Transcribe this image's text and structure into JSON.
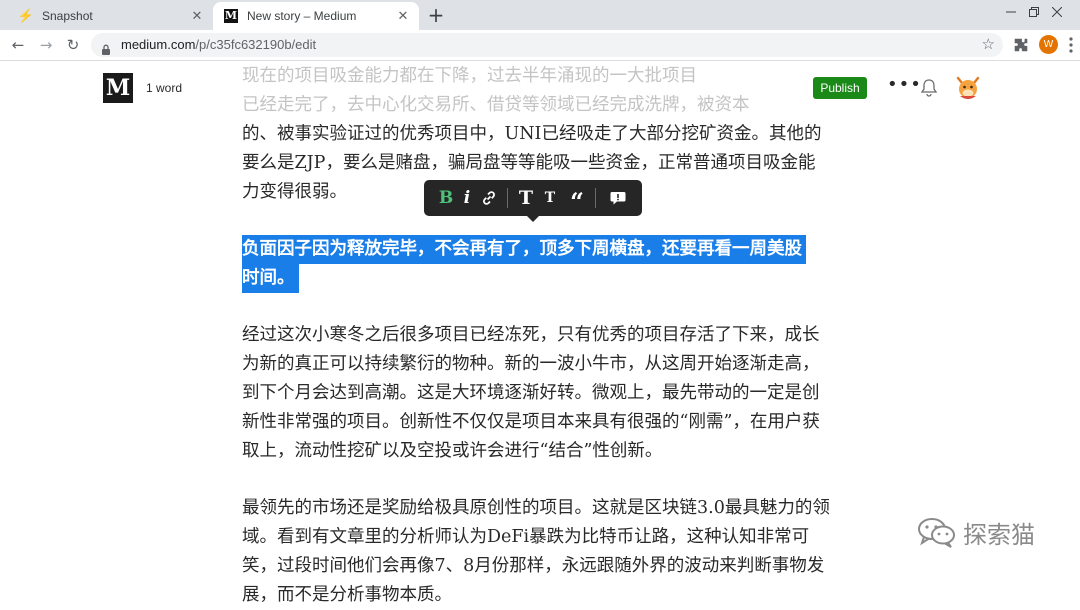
{
  "browser": {
    "tabs": [
      {
        "title": "Snapshot",
        "icon": "lightning-icon",
        "active": false
      },
      {
        "title": "New story – Medium",
        "icon": "medium-logo-icon",
        "active": true
      }
    ],
    "url_host": "medium.com",
    "url_path": "/p/c35fc632190b/edit",
    "profile_initial": "W",
    "icons": [
      "back-arrow-icon",
      "forward-arrow-icon",
      "reload-icon",
      "lock-icon",
      "star-icon",
      "extensions-icon",
      "menu-icon"
    ]
  },
  "editor": {
    "logo": "M",
    "word_count": "1 word",
    "publish_label": "Publish",
    "more_label": "•••"
  },
  "toolbar": {
    "bold": "B",
    "italic": "i",
    "title_big": "T",
    "title_small": "T",
    "quote": "“"
  },
  "article": {
    "faded_lines": [
      "现在的项目吸金能力都在下降，过去半年涌现的一大批项目",
      "已经走完了，去中心化交易所、借贷等领域已经完成洗牌，被资本"
    ],
    "para1": [
      "的、被事实验证过的优秀项目中，UNI已经吸走了大部分挖矿资金。其他的",
      "要么是ZJP，要么是赌盘，骗局盘等等能吸一些资金，正常普通项目吸金能",
      "力变得很弱。"
    ],
    "selected": [
      "负面因子因为释放完毕，不会再有了，顶多下周横盘，还要再看一周美股",
      "时间。"
    ],
    "para3": [
      "经过这次小寒冬之后很多项目已经冻死，只有优秀的项目存活了下来，成长",
      "为新的真正可以持续繁衍的物种。新的一波小牛市，从这周开始逐渐走高，",
      "到下个月会达到高潮。这是大环境逐渐好转。微观上，最先带动的一定是创",
      "新性非常强的项目。创新性不仅仅是项目本来具有很强的“刚需”，在用户获",
      "取上，流动性挖矿以及空投或许会进行“结合”性创新。"
    ],
    "para4": [
      "最领先的市场还是奖励给极具原创性的项目。这就是区块链3.0最具魅力的领",
      "域。看到有文章里的分析师认为DeFi暴跌为比特币让路，这种认知非常可",
      "笑，过段时间他们会再像7、8月份那样，永远跟随外界的波动来判断事物发",
      "展，而不是分析事物本质。"
    ]
  },
  "watermark": {
    "text": "探索猫",
    "icon": "wechat-icon"
  },
  "colors": {
    "publish_green": "#1a8917",
    "selection_blue": "#1a7ee8",
    "bold_active_green": "#4ec17a",
    "profile_orange": "#e37400"
  }
}
